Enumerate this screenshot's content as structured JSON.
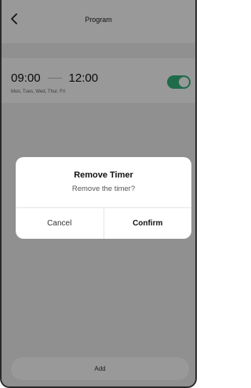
{
  "header": {
    "title": "Program",
    "back_icon": "chevron-left-icon"
  },
  "timer": {
    "start": "09:00",
    "end": "12:00",
    "days": "Mon, Tues, Wed, Thur, Fri",
    "enabled": true,
    "toggle_color": "#35b27d"
  },
  "footer": {
    "add_label": "Add"
  },
  "dialog": {
    "title": "Remove Timer",
    "message": "Remove the timer?",
    "cancel_label": "Cancel",
    "confirm_label": "Confirm"
  }
}
